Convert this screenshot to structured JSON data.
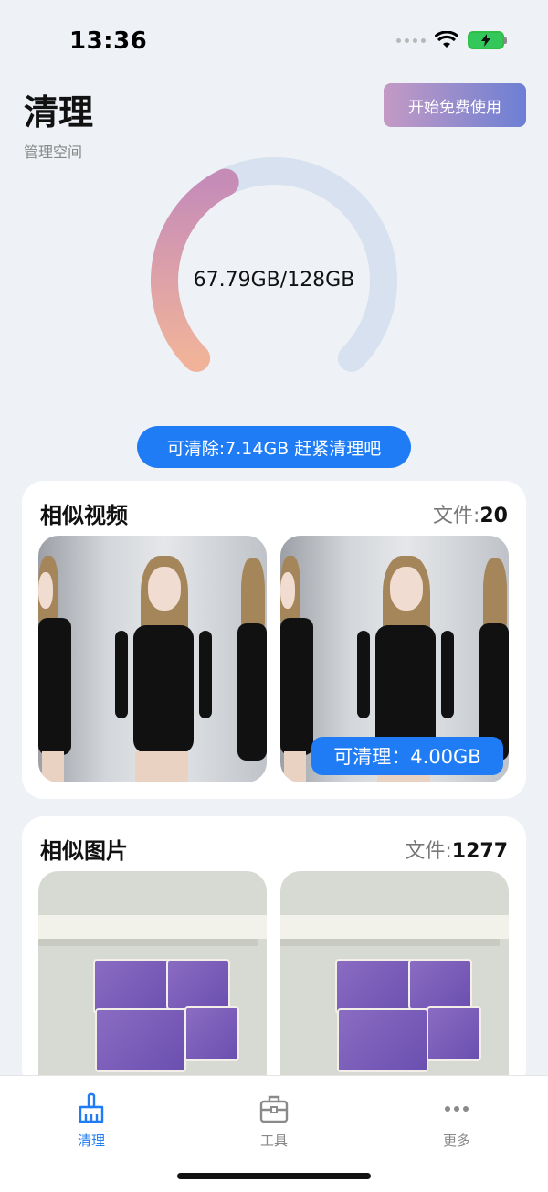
{
  "status_bar": {
    "time": "13:36"
  },
  "header": {
    "title": "清理",
    "subtitle": "管理空间",
    "start_button": "开始免费使用"
  },
  "storage": {
    "usage_text": "67.79GB/128GB",
    "used_gb": 67.79,
    "total_gb": 128,
    "cleanable_text": "可清除:7.14GB 赶紧清理吧"
  },
  "similar_videos": {
    "title": "相似视频",
    "count_label": "文件:",
    "count": "20",
    "badge": "可清理：4.00GB"
  },
  "similar_images": {
    "title": "相似图片",
    "count_label": "文件:",
    "count": "1277"
  },
  "tabs": [
    {
      "label": "清理",
      "icon": "broom-icon",
      "active": true
    },
    {
      "label": "工具",
      "icon": "toolbox-icon",
      "active": false
    },
    {
      "label": "更多",
      "icon": "more-icon",
      "active": false
    }
  ],
  "colors": {
    "accent": "#1f7cf5",
    "ring_track": "#d7e1ef",
    "ring_start": "#c68cb8",
    "ring_end": "#f0b39a"
  }
}
